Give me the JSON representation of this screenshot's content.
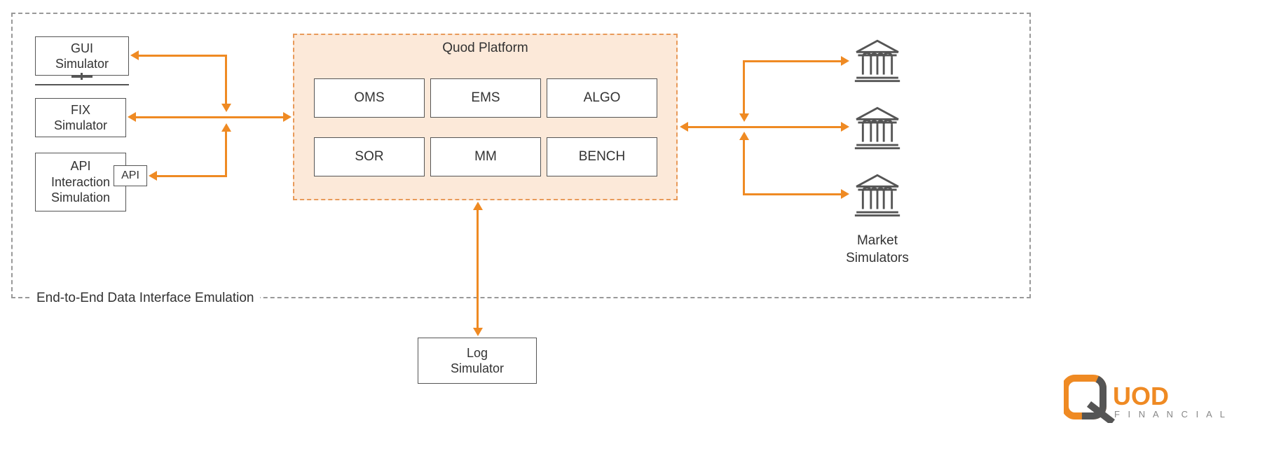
{
  "outer_label": "End-to-End Data Interface Emulation",
  "left": {
    "gui": "GUI\nSimulator",
    "fix": "FIX\nSimulator",
    "api": "API\nInteraction\nSimulation",
    "api_badge": "API"
  },
  "platform": {
    "title": "Quod Platform",
    "modules": [
      "OMS",
      "EMS",
      "ALGO",
      "SOR",
      "MM",
      "BENCH"
    ]
  },
  "bottom": {
    "log": "Log\nSimulator"
  },
  "right": {
    "label": "Market\nSimulators"
  },
  "logo": {
    "brand": "UOD",
    "sub": "F I N A N C I A L"
  }
}
